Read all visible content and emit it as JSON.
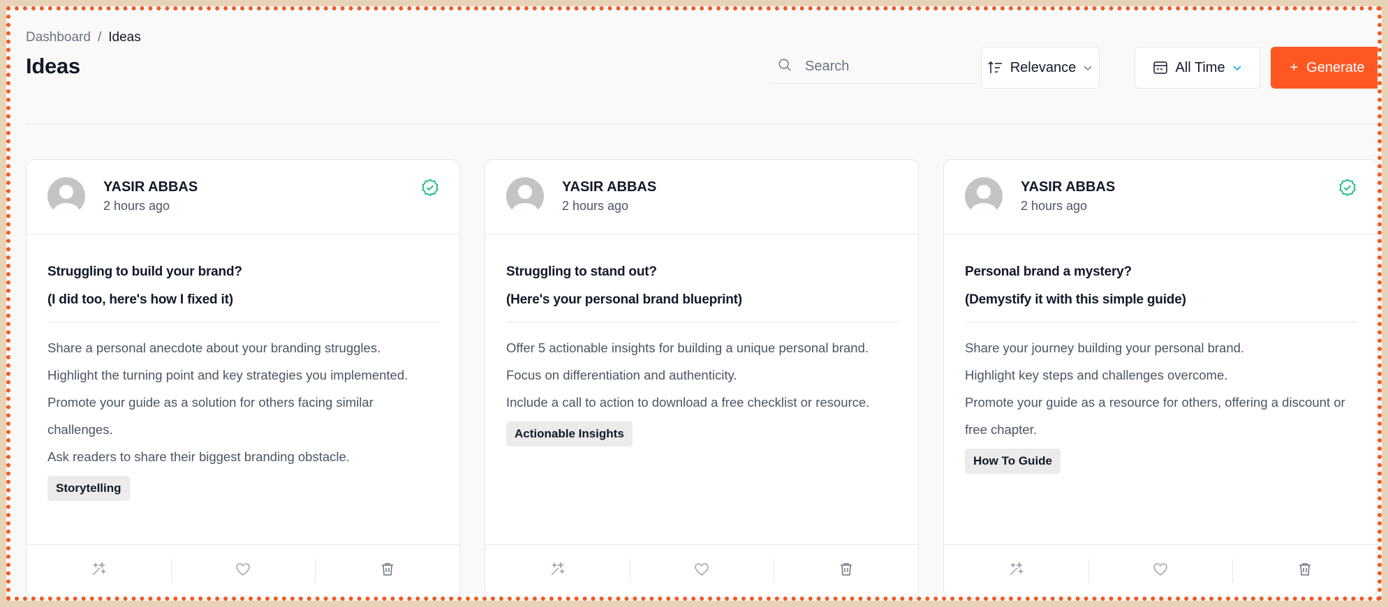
{
  "breadcrumb": {
    "parent": "Dashboard",
    "separator": "/",
    "current": "Ideas"
  },
  "page_title": "Ideas",
  "search": {
    "placeholder": "Search",
    "value": ""
  },
  "sort": {
    "label": "Relevance"
  },
  "time_filter": {
    "label": "All Time"
  },
  "generate": {
    "label": "Generate",
    "plus": "+"
  },
  "colors": {
    "accent": "#ff5722",
    "frame_border": "#f15a22",
    "verified": "#10b981",
    "background_outer": "#e9d3b8"
  },
  "cards": [
    {
      "author": "YASIR ABBAS",
      "time": "2 hours ago",
      "verified": true,
      "hook_line1": "Struggling to build your brand?",
      "hook_line2": "(I did too, here's how I fixed it)",
      "body": [
        "Share a personal anecdote about your branding struggles.",
        "Highlight the turning point and key strategies you implemented.",
        "Promote your guide as a solution for others facing similar challenges.",
        "Ask readers to share their biggest branding obstacle."
      ],
      "tag": "Storytelling"
    },
    {
      "author": "YASIR ABBAS",
      "time": "2 hours ago",
      "verified": false,
      "hook_line1": "Struggling to stand out?",
      "hook_line2": "(Here's your personal brand blueprint)",
      "body": [
        "Offer 5 actionable insights for building a unique personal brand.",
        "Focus on differentiation and authenticity.",
        "Include a call to action to download a free checklist or resource."
      ],
      "tag": "Actionable Insights"
    },
    {
      "author": "YASIR ABBAS",
      "time": "2 hours ago",
      "verified": true,
      "hook_line1": "Personal brand a mystery?",
      "hook_line2": "(Demystify it with this simple guide)",
      "body": [
        "Share your journey building your personal brand.",
        "Highlight key steps and challenges overcome.",
        "Promote your guide as a resource for others, offering a discount or free chapter."
      ],
      "tag": "How To Guide"
    }
  ],
  "icons": {
    "search": "search-icon",
    "sort": "sort-icon",
    "calendar": "calendar-icon",
    "chevron": "chevron-down-icon",
    "verified": "verified-check-icon",
    "magic": "magic-wand-icon",
    "like": "heart-icon",
    "delete": "trash-icon",
    "avatar": "user-avatar-icon"
  }
}
